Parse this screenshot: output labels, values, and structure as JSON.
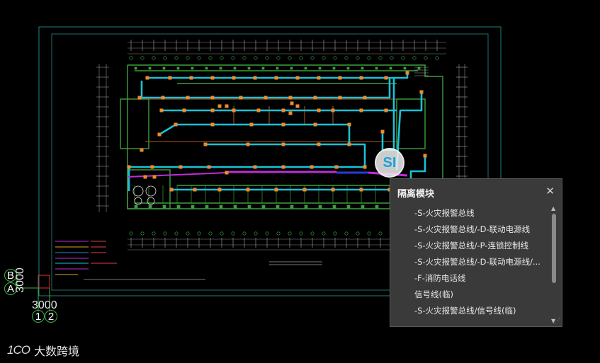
{
  "grid": {
    "row_labels": [
      "B",
      "A"
    ],
    "row_spacing": "3000",
    "column_spacing": "3000",
    "column_labels": [
      "1",
      "2"
    ]
  },
  "badge": {
    "text": "SI"
  },
  "popup": {
    "title": "隔离模块",
    "close_icon": "close-icon",
    "items": [
      "-S-火灾报警总线",
      "-S-火灾报警总线/-D-联动电源线",
      "-S-火灾报警总线/-P-连锁控制线",
      "-S-火灾报警总线/-D-联动电源线/...",
      "-F-消防电话线",
      "信号线(临)",
      "-S-火灾报警总线/信号线(临)"
    ]
  },
  "watermark": {
    "logo": "1CO",
    "text": "大数跨境"
  },
  "colors": {
    "background": "#000000",
    "wire_cyan": "#19c2d6",
    "device_orange": "#f08a2c",
    "wall_green": "#3ca03c",
    "bus_magenta": "#c02cd6",
    "bus_blue": "#2a3ad8"
  }
}
